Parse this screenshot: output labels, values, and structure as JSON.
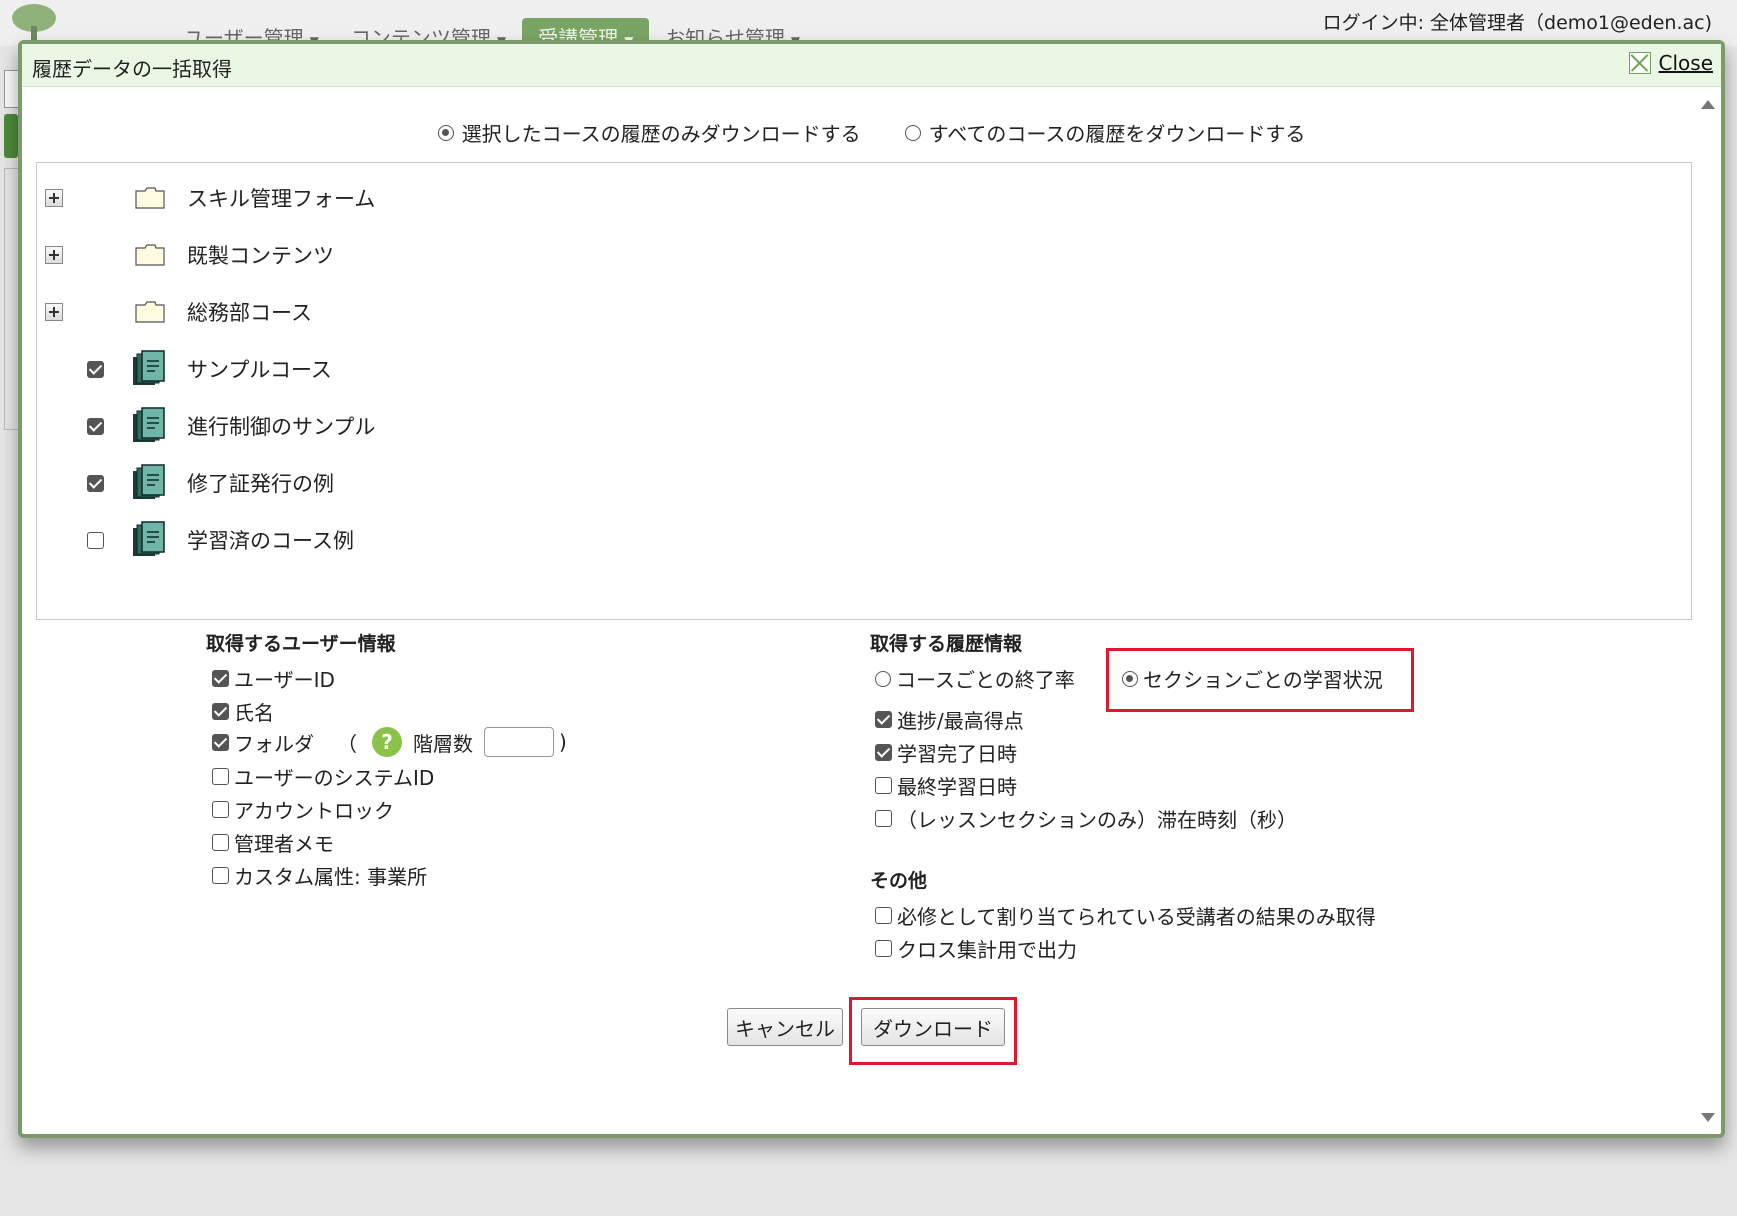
{
  "background": {
    "nav": [
      {
        "label": "ユーザー管理"
      },
      {
        "label": "コンテンツ管理"
      },
      {
        "label": "受講管理"
      },
      {
        "label": "お知らせ管理"
      }
    ],
    "login_text": "ログイン中: 全体管理者（demo1@eden.ac)"
  },
  "dialog": {
    "title": "履歴データの一括取得",
    "close_label": "Close",
    "scope": {
      "selected_only": "選択したコースの履歴のみダウンロードする",
      "all_courses": "すべてのコースの履歴をダウンロードする",
      "selected": "selected_only"
    },
    "tree": [
      {
        "type": "folder",
        "label": "スキル管理フォーム"
      },
      {
        "type": "folder",
        "label": "既製コンテンツ"
      },
      {
        "type": "folder",
        "label": "総務部コース"
      },
      {
        "type": "course",
        "label": "サンプルコース",
        "checked": true
      },
      {
        "type": "course",
        "label": "進行制御のサンプル",
        "checked": true
      },
      {
        "type": "course",
        "label": "修了証発行の例",
        "checked": true
      },
      {
        "type": "course",
        "label": "学習済のコース例",
        "checked": false
      }
    ],
    "user_info": {
      "title": "取得するユーザー情報",
      "user_id": "ユーザーID",
      "name": "氏名",
      "folder": "フォルダ",
      "folder_paren_open": "（",
      "help_glyph": "?",
      "depth_label": "階層数",
      "depth_value": "",
      "folder_paren_close": ")",
      "system_id": "ユーザーのシステムID",
      "account_lock": "アカウントロック",
      "admin_memo": "管理者メモ",
      "custom_attr": "カスタム属性: 事業所"
    },
    "history_info": {
      "title": "取得する履歴情報",
      "per_course": "コースごとの終了率",
      "per_section": "セクションごとの学習状況",
      "progress": "進捗/最高得点",
      "completed_at": "学習完了日時",
      "last_study": "最終学習日時",
      "stay_time": "（レッスンセクションのみ）滞在時刻（秒）"
    },
    "other": {
      "title": "その他",
      "required_only": "必修として割り当てられている受講者の結果のみ取得",
      "cross_tab": "クロス集計用で出力"
    },
    "buttons": {
      "cancel": "キャンセル",
      "download": "ダウンロード"
    },
    "colors": {
      "highlight": "#e0182d",
      "accent": "#7d9a6c",
      "title_bg": "#ebf7e5"
    }
  }
}
